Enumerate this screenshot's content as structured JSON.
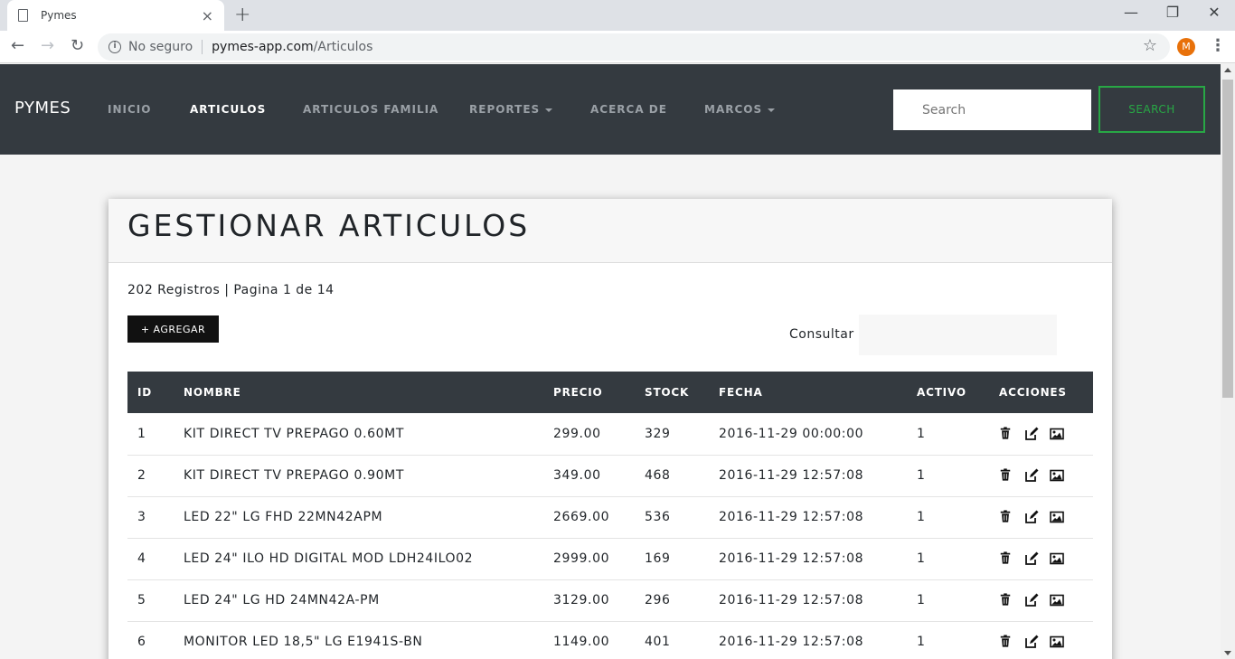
{
  "browser": {
    "tab_title": "Pymes",
    "tab_close": "×",
    "new_tab": "+",
    "security": "No seguro",
    "url_host": "pymes-app.com",
    "url_path": "/Articulos",
    "avatar_letter": "M",
    "back": "←",
    "forward": "→",
    "reload": "↻",
    "star": "☆",
    "minimize": "—",
    "restore": "❐",
    "close": "✕",
    "menu": "⋮"
  },
  "navbar": {
    "brand": "PYMES",
    "links": [
      "INICIO",
      "ARTICULOS",
      "ARTICULOS FAMILIA",
      "REPORTES",
      "ACERCA DE",
      "MARCOS"
    ],
    "search_placeholder": "Search",
    "search_button": "SEARCH"
  },
  "page": {
    "title": "GESTIONAR ARTICULOS",
    "summary": "202 Registros | Pagina 1 de 14",
    "add_button": "+ AGREGAR",
    "consultar_label": "Consultar"
  },
  "table": {
    "headers": [
      "ID",
      "NOMBRE",
      "PRECIO",
      "STOCK",
      "FECHA",
      "ACTIVO",
      "ACCIONES"
    ],
    "rows": [
      [
        "1",
        "KIT DIRECT TV PREPAGO 0.60MT",
        "299.00",
        "329",
        "2016-11-29 00:00:00",
        "1"
      ],
      [
        "2",
        "KIT DIRECT TV PREPAGO 0.90MT",
        "349.00",
        "468",
        "2016-11-29 12:57:08",
        "1"
      ],
      [
        "3",
        "LED 22\" LG FHD 22MN42APM",
        "2669.00",
        "536",
        "2016-11-29 12:57:08",
        "1"
      ],
      [
        "4",
        "LED 24\" ILO HD DIGITAL MOD LDH24ILO02",
        "2999.00",
        "169",
        "2016-11-29 12:57:08",
        "1"
      ],
      [
        "5",
        "LED 24\" LG HD 24MN42A-PM",
        "3129.00",
        "296",
        "2016-11-29 12:57:08",
        "1"
      ],
      [
        "6",
        "MONITOR LED 18,5\" LG E1941S-BN",
        "1149.00",
        "401",
        "2016-11-29 12:57:08",
        "1"
      ]
    ]
  },
  "colors": {
    "navbar_bg": "#343a40",
    "search_button": "#28a745",
    "avatar": "#e8710a"
  },
  "icons": {
    "row_actions": [
      "trash-icon",
      "edit-icon",
      "image-icon"
    ]
  }
}
